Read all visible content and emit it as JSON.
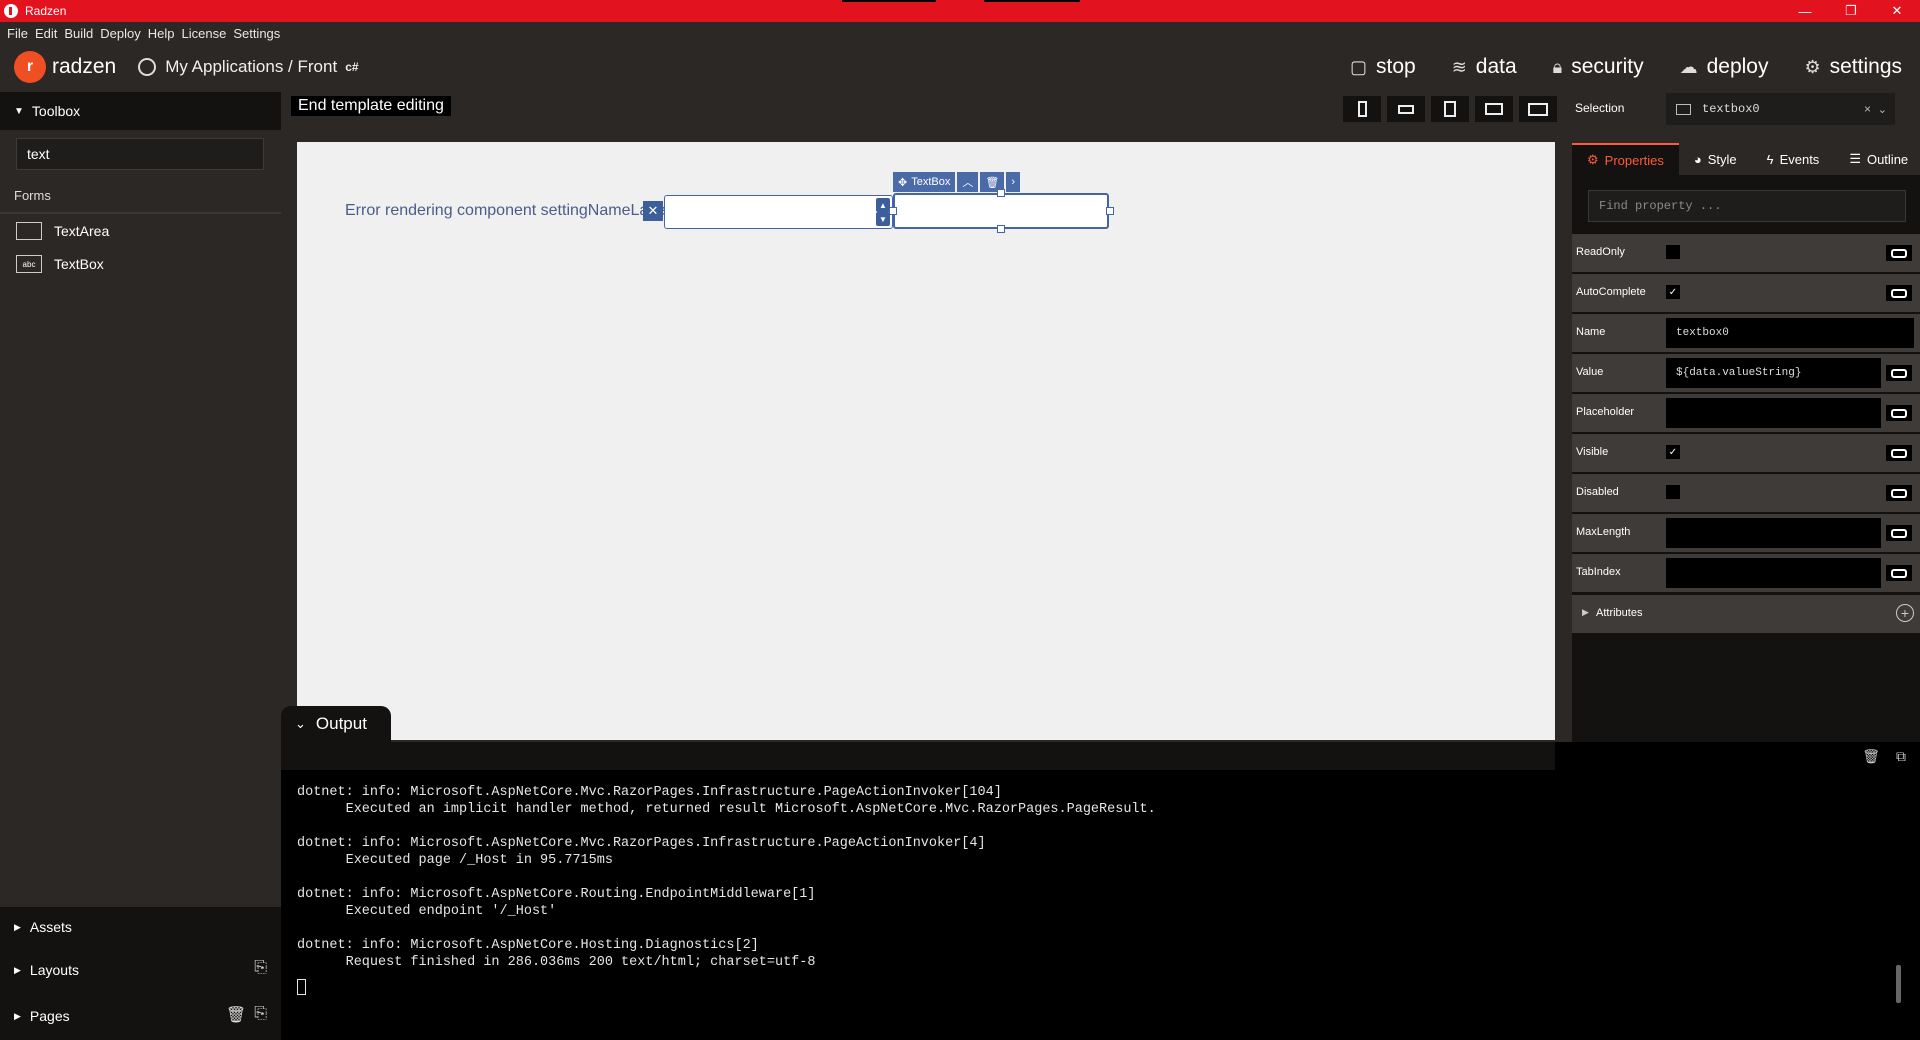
{
  "window": {
    "title": "Radzen",
    "minimize": "—",
    "restore": "❐",
    "close": "✕"
  },
  "menu": [
    "File",
    "Edit",
    "Build",
    "Deploy",
    "Help",
    "License",
    "Settings"
  ],
  "brand": {
    "name": "radzen"
  },
  "breadcrumb": {
    "text": "My Applications / Front",
    "lang": "c#"
  },
  "topnav": {
    "stop": "stop",
    "data": "data",
    "security": "security",
    "deploy": "deploy",
    "settings": "settings"
  },
  "toolbox": {
    "title": "Toolbox",
    "search_value": "text",
    "section": "Forms",
    "items": [
      {
        "label": "TextArea",
        "icon": "textarea-icon"
      },
      {
        "label": "TextBox",
        "icon": "textbox-icon",
        "icon_text": "abc"
      }
    ],
    "bottom": {
      "assets": "Assets",
      "layouts": "Layouts",
      "pages": "Pages"
    }
  },
  "designer": {
    "end_template": "End template editing",
    "error_text": "Error rendering component settingNameLabel.",
    "selection_tag": "TextBox"
  },
  "output": {
    "title": "Output",
    "lines": [
      "dotnet: info: Microsoft.AspNetCore.Mvc.RazorPages.Infrastructure.PageActionInvoker[104]",
      "      Executed an implicit handler method, returned result Microsoft.AspNetCore.Mvc.RazorPages.PageResult.",
      "",
      "dotnet: info: Microsoft.AspNetCore.Mvc.RazorPages.Infrastructure.PageActionInvoker[4]",
      "      Executed page /_Host in 95.7715ms",
      "",
      "dotnet: info: Microsoft.AspNetCore.Routing.EndpointMiddleware[1]",
      "      Executed endpoint '/_Host'",
      "",
      "dotnet: info: Microsoft.AspNetCore.Hosting.Diagnostics[2]",
      "      Request finished in 286.036ms 200 text/html; charset=utf-8"
    ]
  },
  "properties": {
    "selection_label": "Selection",
    "selection_value": "textbox0",
    "tabs": {
      "properties": "Properties",
      "style": "Style",
      "events": "Events",
      "outline": "Outline"
    },
    "find_placeholder": "Find property ...",
    "rows": {
      "readonly": {
        "label": "ReadOnly",
        "checked": false
      },
      "autocomplete": {
        "label": "AutoComplete",
        "checked": true,
        "mark": "✓"
      },
      "name": {
        "label": "Name",
        "value": "textbox0"
      },
      "value": {
        "label": "Value",
        "value": "${data.valueString}"
      },
      "placeholder": {
        "label": "Placeholder",
        "value": ""
      },
      "visible": {
        "label": "Visible",
        "checked": true,
        "mark": "✓"
      },
      "disabled": {
        "label": "Disabled",
        "checked": false
      },
      "maxlength": {
        "label": "MaxLength",
        "value": ""
      },
      "tabindex": {
        "label": "TabIndex",
        "value": ""
      }
    },
    "attributes": "Attributes"
  },
  "colors": {
    "accent": "#e3121f",
    "brand": "#f04e23",
    "active_tab": "#ff5a3d",
    "selection": "#4464a8"
  }
}
